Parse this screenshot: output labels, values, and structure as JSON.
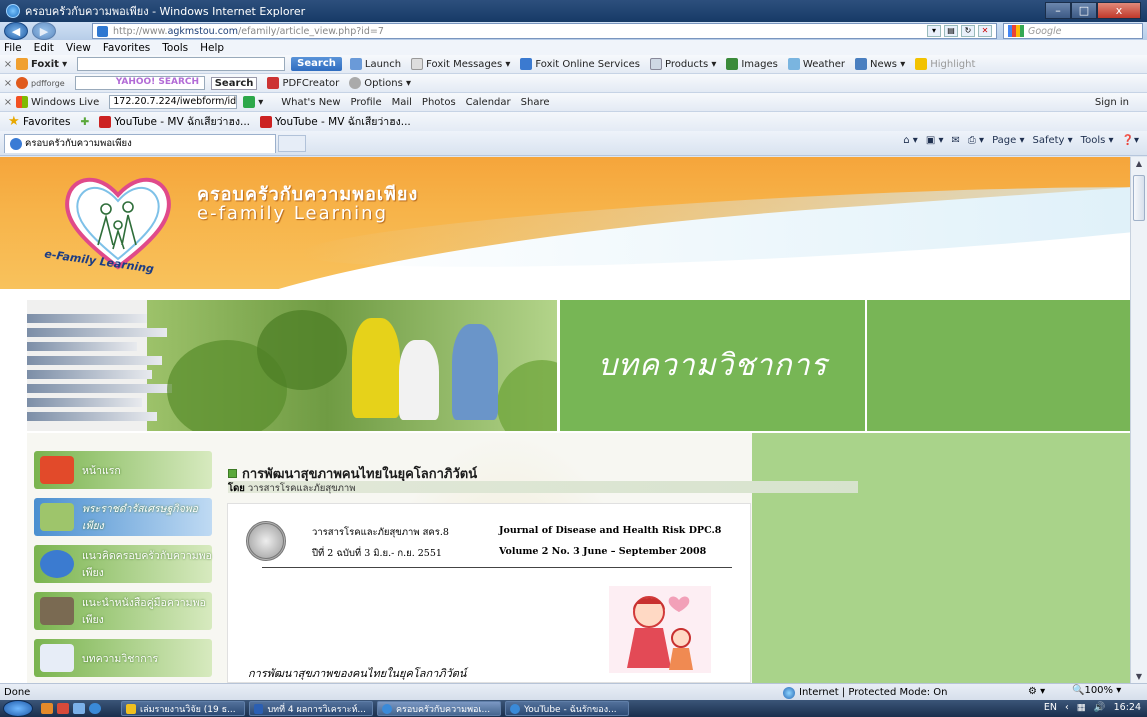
{
  "window": {
    "title": "ครอบครัวกับความพอเพียง - Windows Internet Explorer",
    "controls": [
      "–",
      "□",
      "x"
    ]
  },
  "address": {
    "url_prefix": "http://www.",
    "url_domain": "agkmstou.com",
    "url_path": "/efamily/article_view.php?id=7",
    "search_placeholder": "Google"
  },
  "menu": [
    "File",
    "Edit",
    "View",
    "Favorites",
    "Tools",
    "Help"
  ],
  "foxit_toolbar": {
    "brand": "Foxit",
    "search_label": "Search",
    "items": [
      "Launch",
      "Foxit Messages",
      "Foxit Online Services",
      "Products",
      "Images",
      "Weather",
      "News",
      "Highlight"
    ]
  },
  "yahoo_toolbar": {
    "brand": "pdfforge",
    "search_brand": "YAHOO! SEARCH",
    "search_label": "Search",
    "items": [
      "PDFCreator",
      "Options"
    ]
  },
  "live_toolbar": {
    "brand": "Windows Live",
    "field_value": "172.20.7.224/iwebform/idispl",
    "items": [
      "What's New",
      "Profile",
      "Mail",
      "Photos",
      "Calendar",
      "Share"
    ],
    "signin": "Sign in"
  },
  "favorites": {
    "label": "Favorites",
    "links": [
      "YouTube - MV ฉักเสียว่าฮง...",
      "YouTube - MV ฉักเสียว่าฮง..."
    ]
  },
  "tab": {
    "title": "ครอบครัวกับความพอเพียง"
  },
  "command_bar": [
    "Page ▾",
    "Safety ▾",
    "Tools ▾"
  ],
  "site": {
    "title_th": "ครอบครัวกับความพอเพียง",
    "title_en": "e-family Learning",
    "logo_text": "e-Family Learning",
    "hero_caption": "บทความวิชาการ"
  },
  "sidebar": [
    {
      "label": "หน้าแรก"
    },
    {
      "label": "พระราชดำรัสเศรษฐกิจพอเพียง"
    },
    {
      "label": "แนวคิดครอบครัวกับความพอเพียง"
    },
    {
      "label": "แนะนำหนังสือคู่มือความพอเพียง"
    },
    {
      "label": "บทความวิชาการ"
    }
  ],
  "article": {
    "title": "การพัฒนาสุขภาพคนไทยในยุคโลกาภิวัตน์",
    "byline_prefix": "โดย",
    "byline_source": "วารสารโรคและภัยสุขภาพ",
    "journal_th": "วารสารโรคและภัยสุขภาพ สคร.8",
    "journal_en": "Journal of Disease and Health Risk DPC.8",
    "issue_th": "ปีที่ 2 ฉบับที่ 3 มิ.ย.- ก.ย. 2551",
    "issue_en": "Volume 2 No. 3 June – September 2008",
    "doc_heading": "การพัฒนาสุขภาพของคนไทยในยุคโลกาภิวัตน์"
  },
  "status": {
    "text": "Done",
    "zone": "Internet | Protected Mode: On",
    "zoom": "100%"
  },
  "taskbar": {
    "tasks": [
      "เล่มรายงานวิจัย (19 ธ...",
      "บทที่ 4 ผลการวิเคราะห์...",
      "ครอบครัวกับความพอเ...",
      "YouTube - ฉันรักของ..."
    ],
    "lang": "EN",
    "time": "16:24"
  },
  "colors": {
    "banner_orange": "#f7b349",
    "hero_green": "#77b655",
    "content_green": "#a9d38a"
  }
}
